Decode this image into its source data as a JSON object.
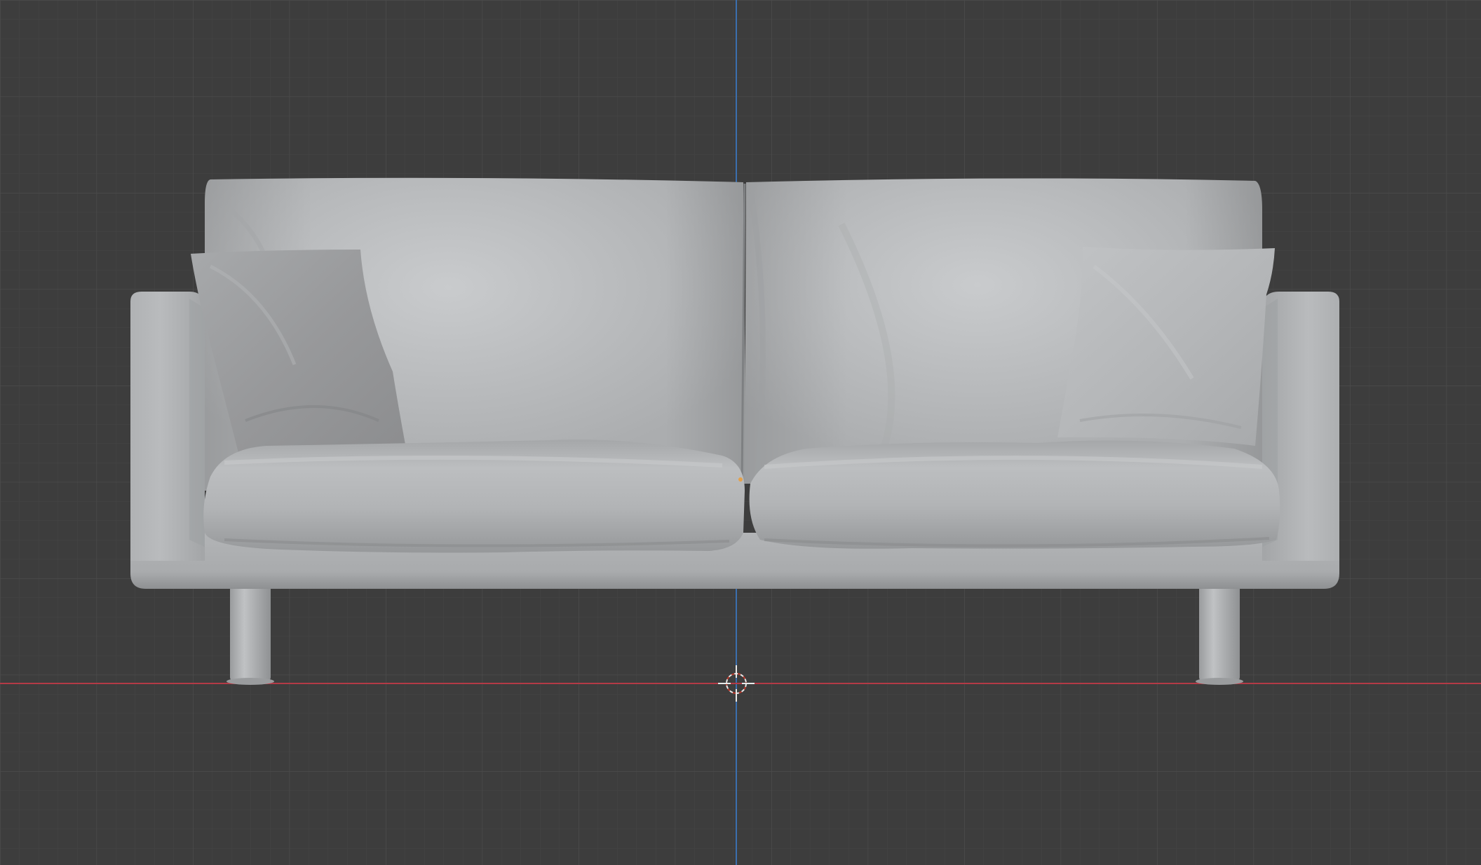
{
  "viewport": {
    "name": "3D Viewport",
    "view": "front-orthographic",
    "shading": "solid",
    "background_color": "#3d3d3d",
    "grid_minor_color": "#464646",
    "grid_major_color": "#4e4e4e",
    "x_axis_color": "#b43a46",
    "z_axis_color": "#3b6fae",
    "cursor_color": "#e8e8e8"
  },
  "scene": {
    "object": "sofa",
    "parts": [
      "sofa-base",
      "left-armrest",
      "right-armrest",
      "left-back-cushion",
      "right-back-cushion",
      "left-seat-cushion",
      "right-seat-cushion",
      "left-throw-pillow",
      "right-throw-pillow",
      "left-leg",
      "right-leg"
    ],
    "material_color": "#b5b7b9"
  },
  "overlays": {
    "3d_cursor": "crosshair-cursor-icon",
    "origin_point": "origin-dot-icon"
  }
}
